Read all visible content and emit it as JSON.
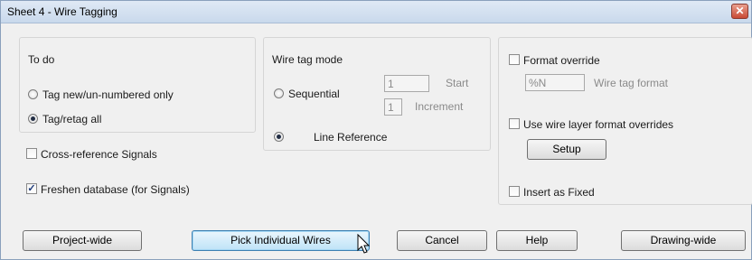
{
  "window": {
    "title": "Sheet 4 - Wire Tagging",
    "close_glyph": "✕"
  },
  "todo": {
    "heading": "To do",
    "options": [
      {
        "label": "Tag new/un-numbered only",
        "selected": false
      },
      {
        "label": "Tag/retag all",
        "selected": true
      }
    ]
  },
  "signals": {
    "cross_reference": {
      "label": "Cross-reference Signals",
      "checked": false
    },
    "freshen_database": {
      "label": "Freshen database (for Signals)",
      "checked": true
    }
  },
  "wire_tag_mode": {
    "heading": "Wire tag mode",
    "sequential": {
      "label": "Sequential",
      "selected": false
    },
    "start": {
      "value": "1",
      "label": "Start"
    },
    "increment": {
      "value": "1",
      "label": "Increment"
    },
    "line_reference": {
      "label": "Line Reference",
      "selected": true
    }
  },
  "format": {
    "format_override": {
      "label": "Format override",
      "checked": false
    },
    "wire_tag_format": {
      "value": "%N",
      "label": "Wire tag format"
    },
    "layer_overrides": {
      "label": "Use wire layer format overrides",
      "checked": false
    },
    "setup_label": "Setup",
    "insert_fixed": {
      "label": "Insert as Fixed",
      "checked": false
    }
  },
  "buttons": {
    "project_wide": "Project-wide",
    "pick_individual": "Pick Individual Wires",
    "cancel": "Cancel",
    "help": "Help",
    "drawing_wide": "Drawing-wide"
  },
  "check_glyph": "✓"
}
